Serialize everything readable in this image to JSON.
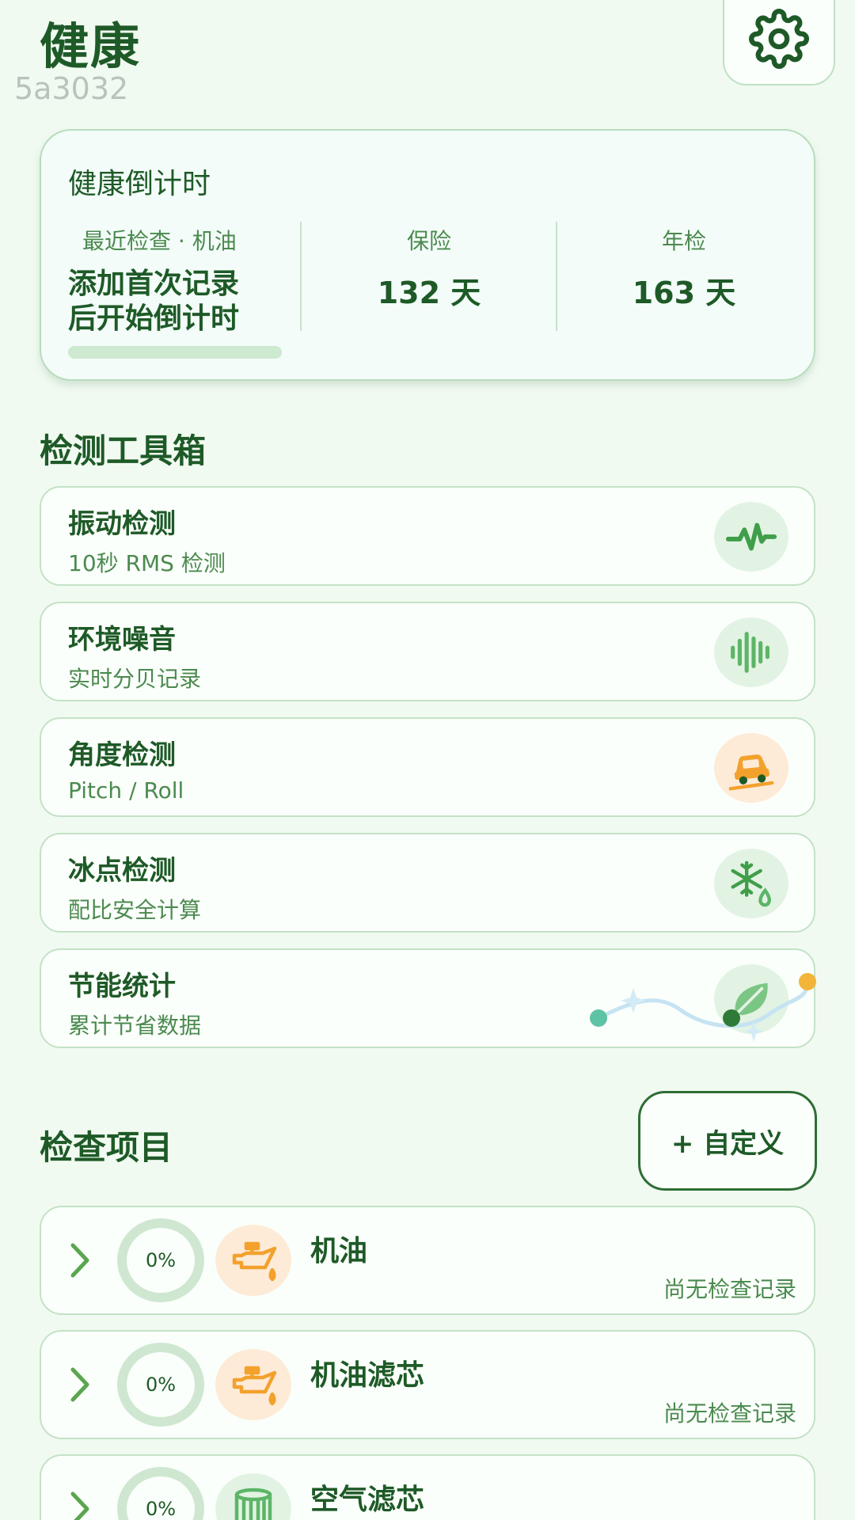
{
  "header": {
    "title": "健康",
    "build_id": "5a3032"
  },
  "countdown": {
    "title": "健康倒计时",
    "recent_label": "最近检查 · 机油",
    "recent_hint_line1": "添加首次记录",
    "recent_hint_line2": "后开始倒计时",
    "insurance_label": "保险",
    "insurance_value": "132 天",
    "inspection_label": "年检",
    "inspection_value": "163 天"
  },
  "toolbox": {
    "title": "检测工具箱",
    "items": [
      {
        "name": "振动检测",
        "subtitle": "10秒 RMS 检测",
        "icon": "vibration-wave-icon"
      },
      {
        "name": "环境噪音",
        "subtitle": "实时分贝记录",
        "icon": "sound-wave-icon"
      },
      {
        "name": "角度检测",
        "subtitle": "Pitch / Roll",
        "icon": "car-tilt-icon"
      },
      {
        "name": "冰点检测",
        "subtitle": "配比安全计算",
        "icon": "snowflake-drop-icon"
      },
      {
        "name": "节能统计",
        "subtitle": "累计节省数据",
        "icon": "leaf-icon"
      }
    ]
  },
  "checks": {
    "title": "检查项目",
    "custom_button": "+ 自定义",
    "items": [
      {
        "name": "机油",
        "progress": "0%",
        "status": "尚无检查记录",
        "icon": "oil-can-icon"
      },
      {
        "name": "机油滤芯",
        "progress": "0%",
        "status": "尚无检查记录",
        "icon": "oil-can-icon"
      },
      {
        "name": "空气滤芯",
        "progress": "0%",
        "status": "",
        "icon": "air-filter-icon"
      }
    ]
  },
  "colors": {
    "background": "#f1faf1",
    "primary_text": "#1e5a27",
    "accent_green": "#3f9e4a",
    "accent_orange": "#f3a12d"
  }
}
